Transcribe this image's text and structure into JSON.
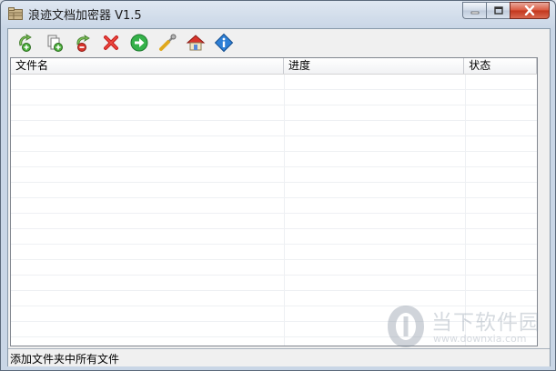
{
  "window": {
    "title": "浪迹文档加密器 V1.5",
    "icon": "app-folder-icon"
  },
  "caption_buttons": [
    {
      "name": "minimize-button",
      "icon": "minimize-icon"
    },
    {
      "name": "maximize-button",
      "icon": "maximize-icon"
    },
    {
      "name": "close-button",
      "icon": "close-icon"
    }
  ],
  "toolbar": {
    "buttons": [
      {
        "name": "add-files-button",
        "icon": "add-files-icon"
      },
      {
        "name": "add-folder-button",
        "icon": "add-folder-icon"
      },
      {
        "name": "remove-file-button",
        "icon": "remove-file-icon"
      },
      {
        "name": "delete-button",
        "icon": "red-x-icon"
      },
      {
        "name": "start-button",
        "icon": "green-arrow-icon"
      },
      {
        "name": "settings-button",
        "icon": "wrench-icon"
      },
      {
        "name": "home-button",
        "icon": "home-icon"
      },
      {
        "name": "about-button",
        "icon": "info-icon"
      }
    ]
  },
  "table": {
    "columns": [
      "文件名",
      "进度",
      "状态"
    ],
    "rows": []
  },
  "watermark": {
    "text": "当下软件园",
    "url": "www.downxia.com"
  },
  "status": {
    "text": "添加文件夹中所有文件"
  },
  "colors": {
    "titlebar": "#c9d6e6",
    "close_button": "#c2361c",
    "window_bg": "#f0f0f0"
  }
}
